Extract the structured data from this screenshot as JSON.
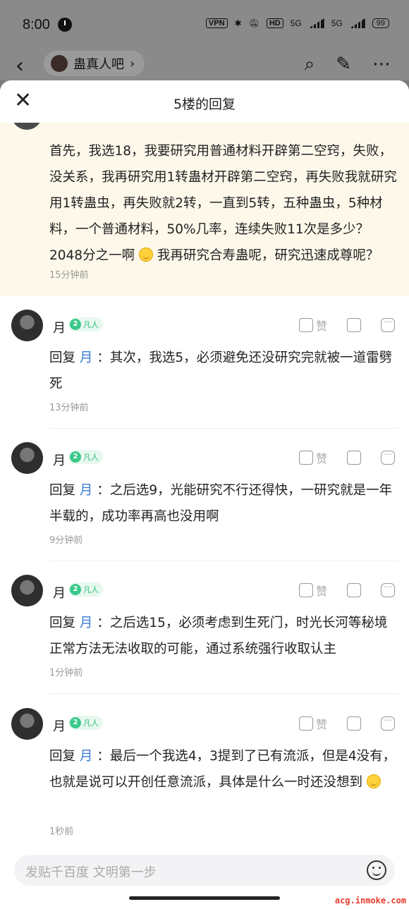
{
  "status_bar": {
    "time": "8:00",
    "vpn": "VPN",
    "hd": "HD",
    "net1": "5G",
    "net2": "5G",
    "battery": "99"
  },
  "app_bar": {
    "forum_name": "蛊真人吧"
  },
  "sheet": {
    "title": "5楼的回复"
  },
  "main_post": {
    "text": "首先，我选18，我要研究用普通材料开辟第二空窍，失败，没关系，我再研究用1转蛊材开辟第二空窍，再失败我就研究用1转蛊虫，再失败就2转，一直到5转，五种蛊虫，5种材料，一个普通材料，50%几率，连续失败11次是多少？2048分之一啊",
    "text_tail": "我再研究合寿蛊呢，研究迅速成尊呢？",
    "time": "15分钟前"
  },
  "replies": [
    {
      "user": "月",
      "level": "2",
      "level_title": "凡人",
      "reply_prefix": "回复",
      "reply_to": "月",
      "text": "：其次，我选5，必须避免还没研究完就被一道雷劈死",
      "time": "13分钟前",
      "like_label": "赞"
    },
    {
      "user": "月",
      "level": "2",
      "level_title": "凡人",
      "reply_prefix": "回复",
      "reply_to": "月",
      "text": "：之后选9，光能研究不行还得快，一研究就是一年半载的，成功率再高也没用啊",
      "time": "9分钟前",
      "like_label": "赞"
    },
    {
      "user": "月",
      "level": "2",
      "level_title": "凡人",
      "reply_prefix": "回复",
      "reply_to": "月",
      "text": "：之后选15，必须考虑到生死门，时光长河等秘境正常方法无法收取的可能，通过系统强行收取认主",
      "time": "1分钟前",
      "like_label": "赞"
    },
    {
      "user": "月",
      "level": "2",
      "level_title": "凡人",
      "reply_prefix": "回复",
      "reply_to": "月",
      "text": "：最后一个我选4，3提到了已有流派，但是4没有，也就是说可以开创任意流派，具体是什么一时还没想到",
      "time": "1秒前",
      "like_label": "赞"
    }
  ],
  "input": {
    "placeholder": "发贴千百度 文明第一步"
  },
  "watermark": "acg.inmoke.com"
}
